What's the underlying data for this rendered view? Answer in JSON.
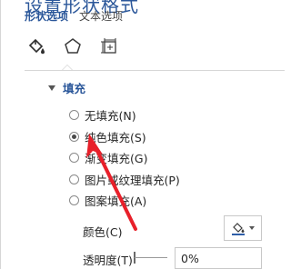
{
  "pane": {
    "title": "设置形状格式"
  },
  "tabs": [
    {
      "label": "形状选项"
    },
    {
      "label": "文本选项"
    }
  ],
  "category_icons": [
    "fill-bucket-icon",
    "pentagon-icon",
    "size-properties-icon"
  ],
  "fill_section": {
    "title": "填充",
    "options": [
      {
        "label": "无填充(N)",
        "checked": false
      },
      {
        "label": "纯色填充(S)",
        "checked": true
      },
      {
        "label": "渐变填充(G)",
        "checked": false
      },
      {
        "label": "图片或纹理填充(P)",
        "checked": false
      },
      {
        "label": "图案填充(A)",
        "checked": false
      }
    ],
    "color_label": "颜色(C)",
    "transparency_label": "透明度(T)",
    "transparency_value": "0%"
  },
  "colors": {
    "accent": "#2b579a",
    "annotation_arrow": "#e8202a",
    "border": "#d6d6d6"
  }
}
